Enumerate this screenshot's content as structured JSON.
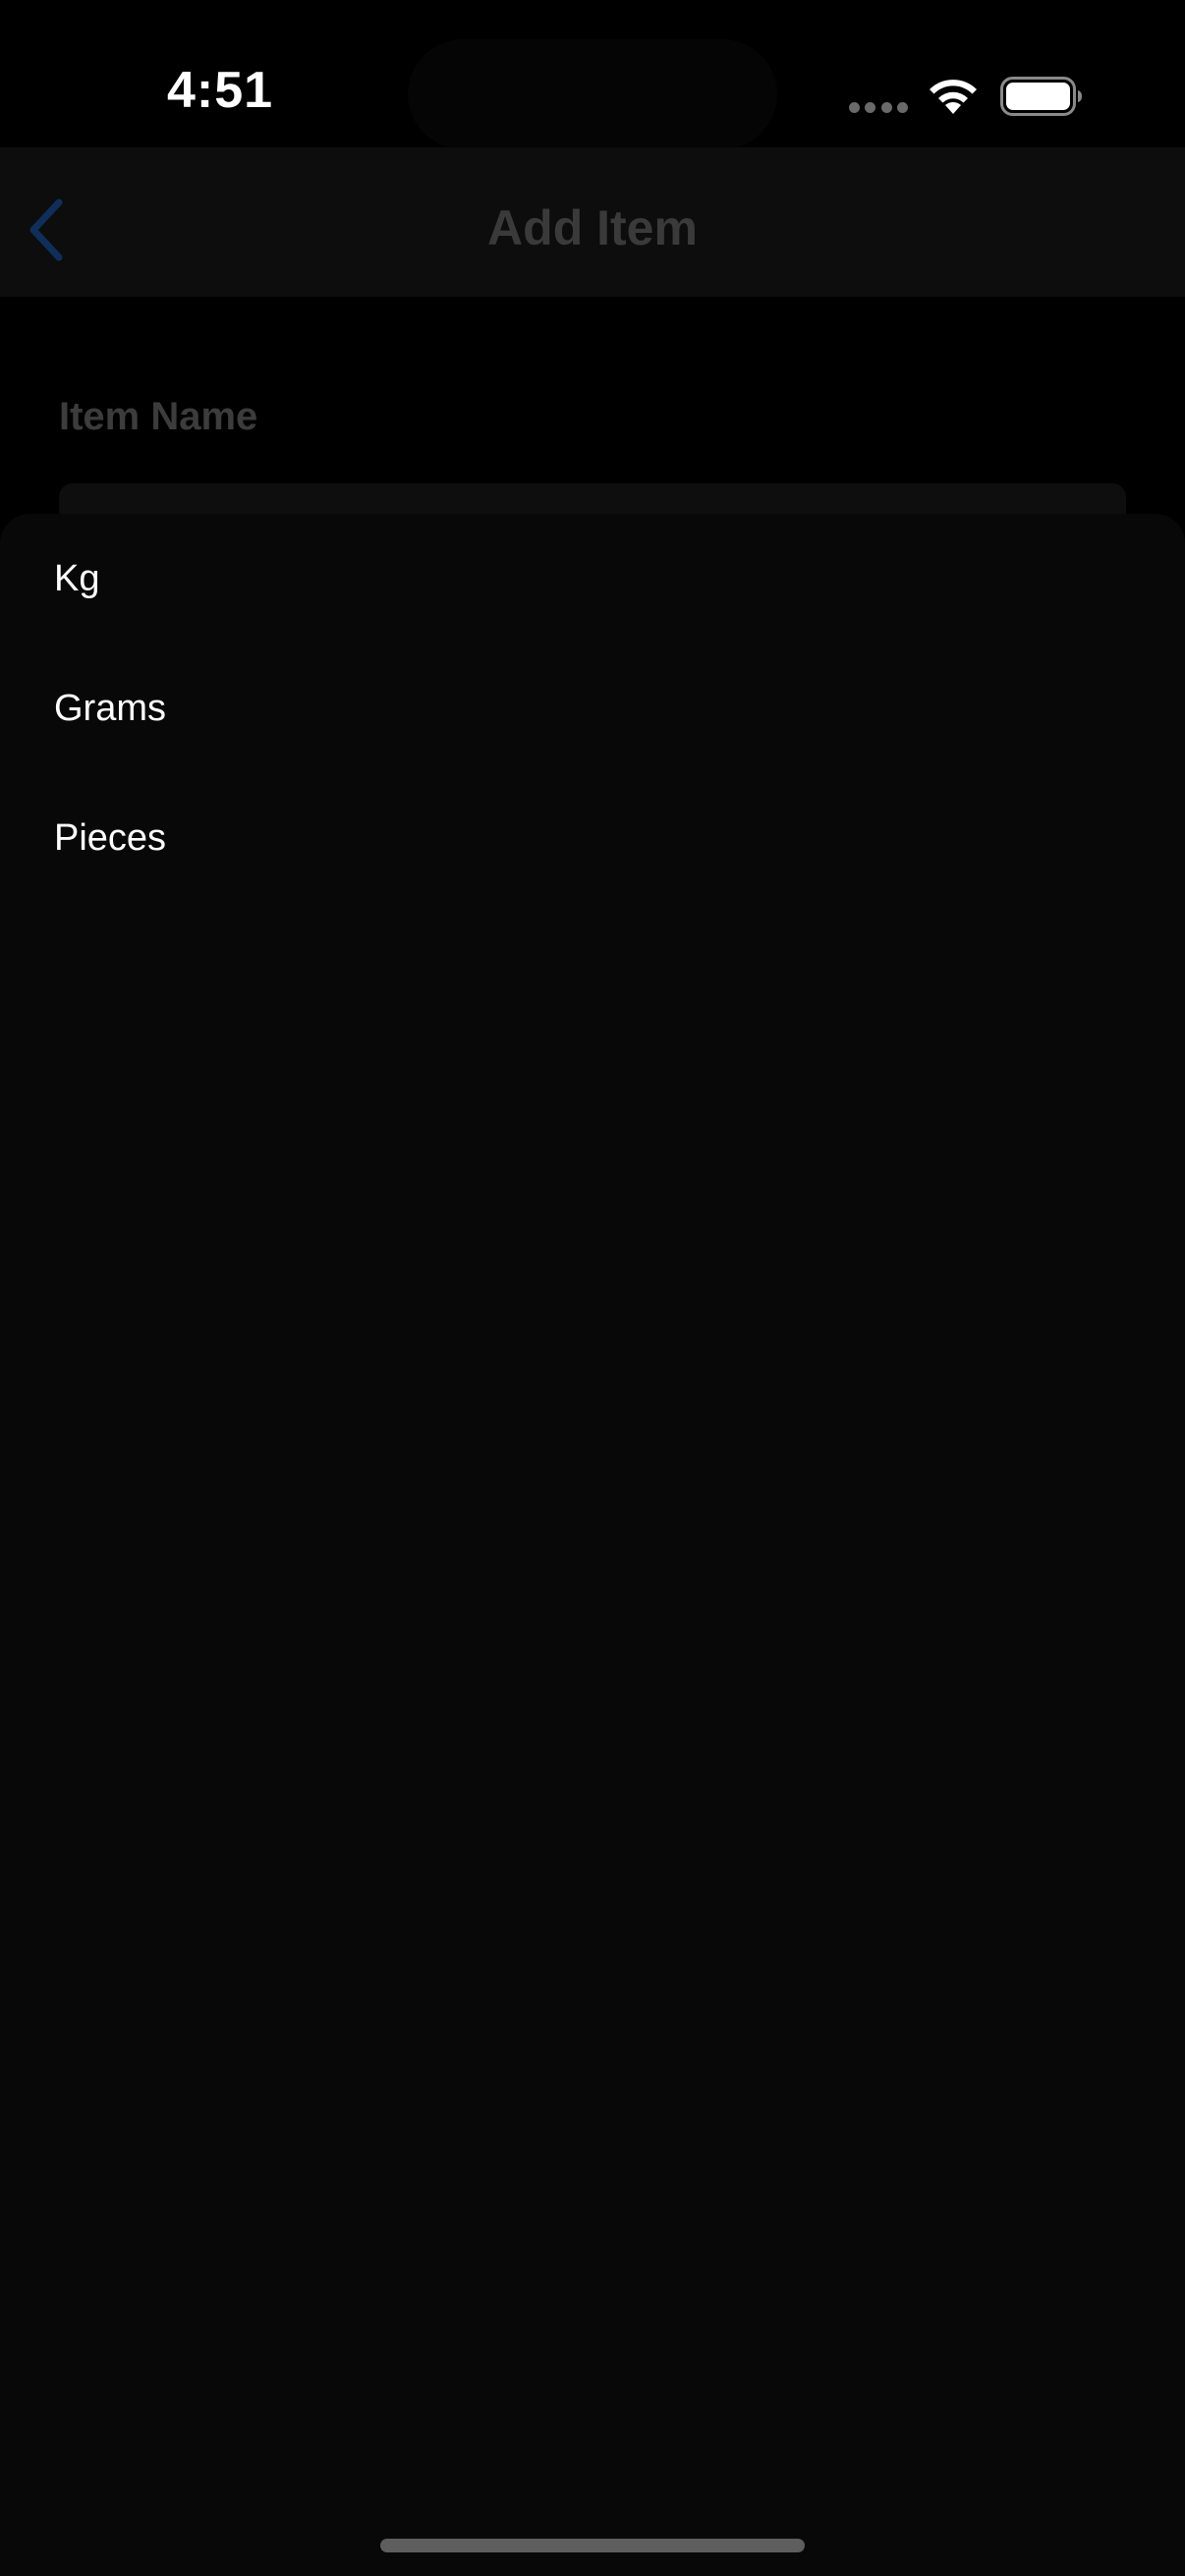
{
  "status_bar": {
    "time": "4:51",
    "wifi_icon": "wifi-icon",
    "battery_icon": "battery-icon"
  },
  "nav": {
    "title": "Add Item",
    "back_icon": "chevron-left-icon",
    "accent_color": "#0a84ff"
  },
  "form": {
    "item_name_label": "Item Name",
    "item_name_value": ""
  },
  "unit_sheet": {
    "options": [
      {
        "label": "Kg"
      },
      {
        "label": "Grams"
      },
      {
        "label": "Pieces"
      }
    ]
  }
}
